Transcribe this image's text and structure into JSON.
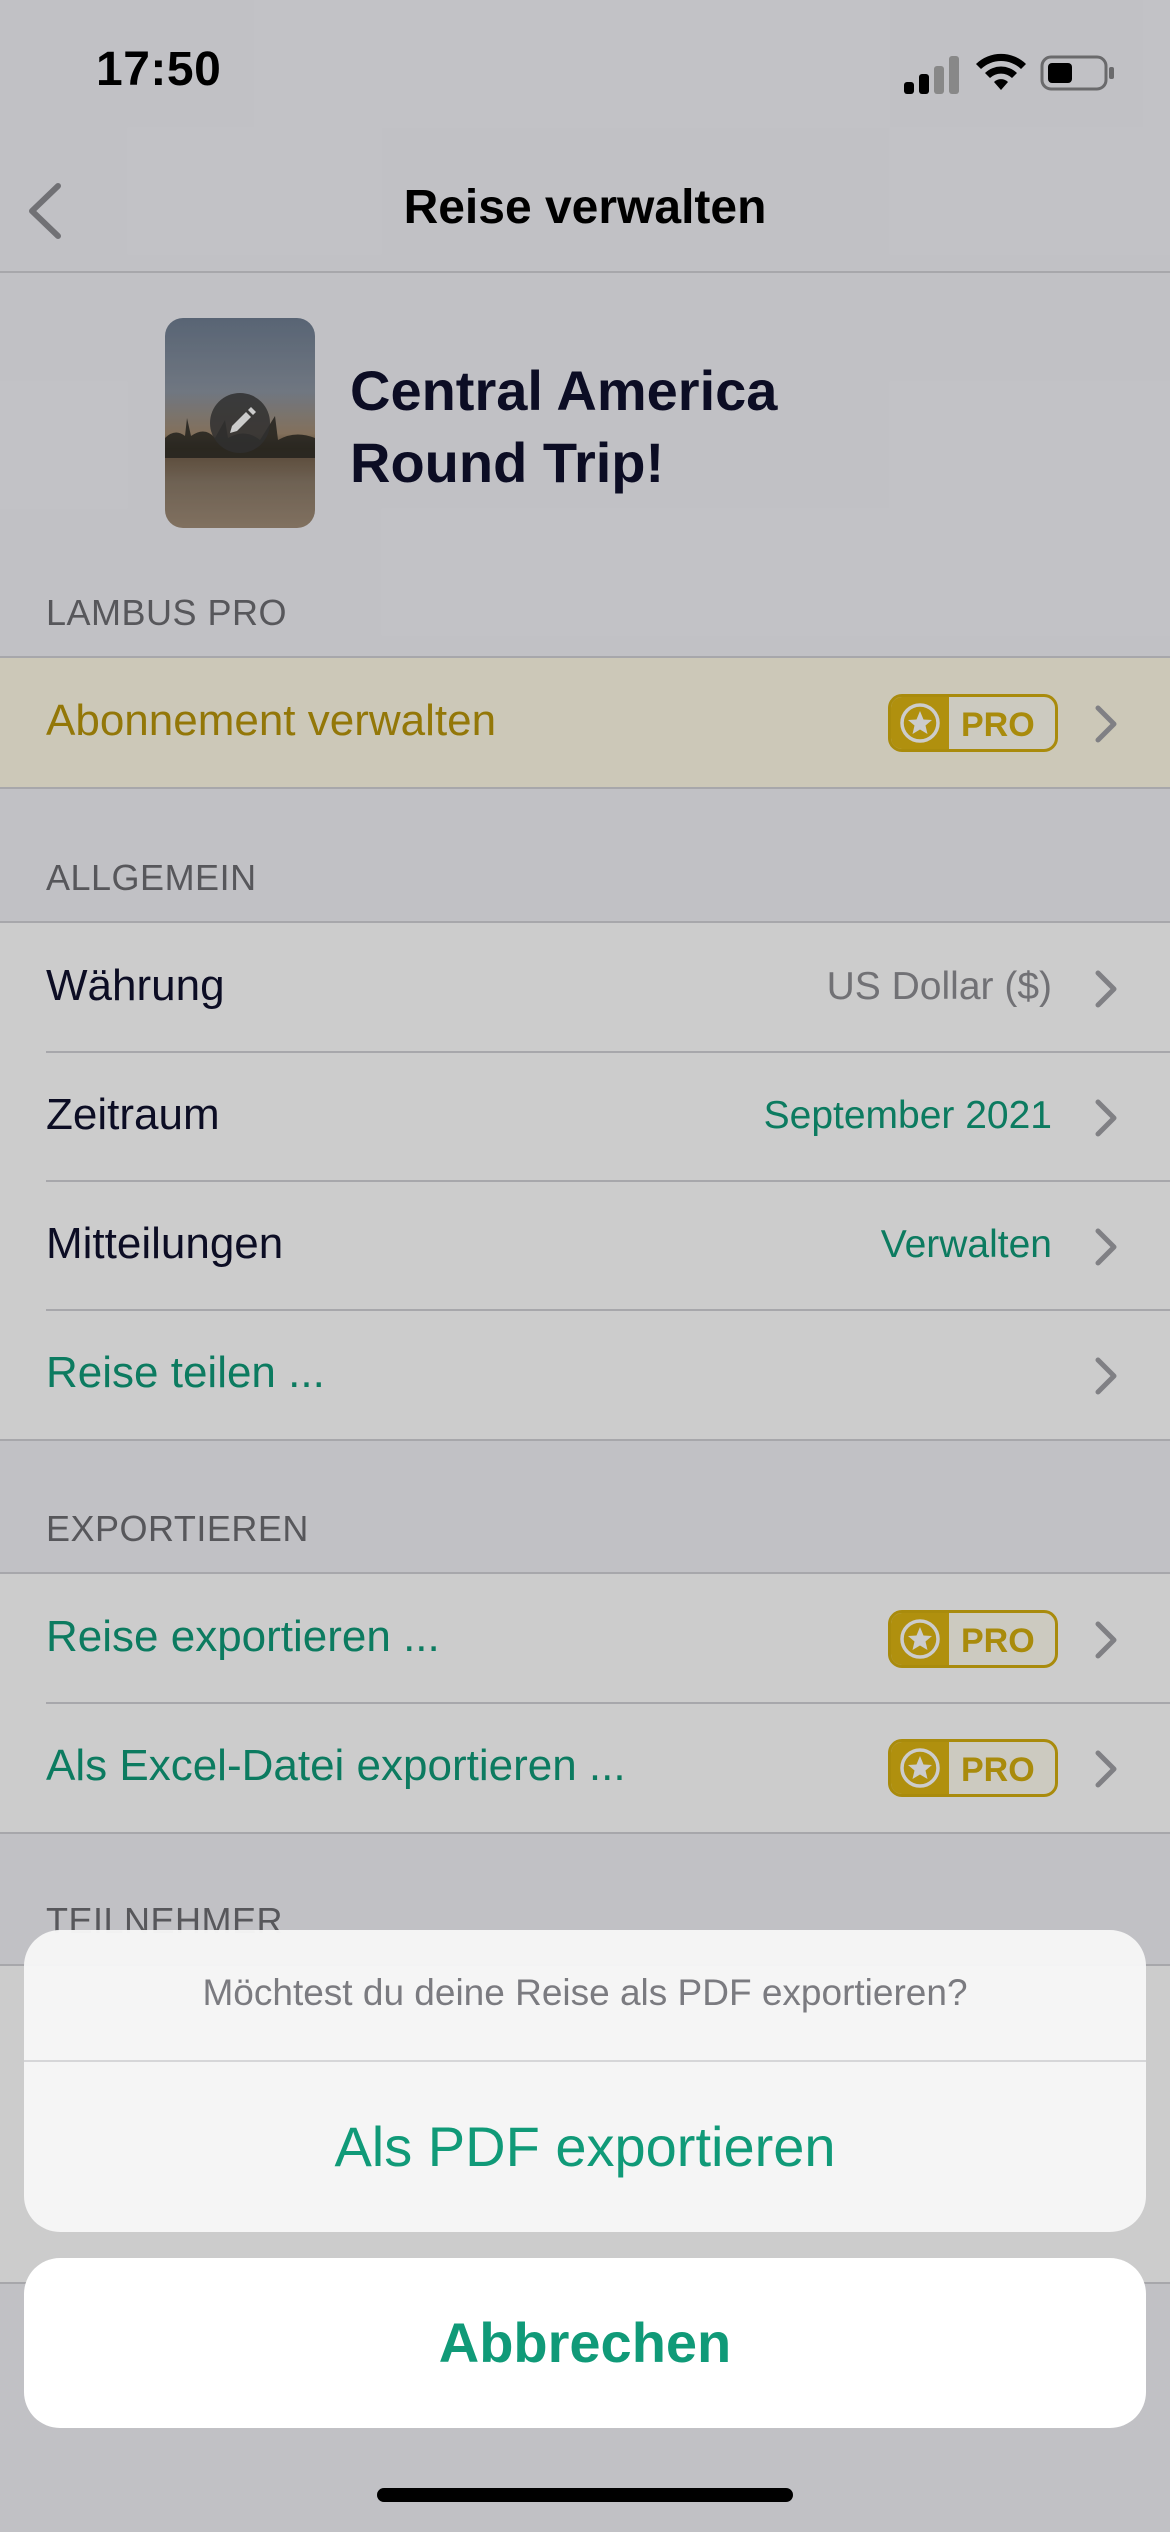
{
  "status_bar": {
    "time": "17:50"
  },
  "nav": {
    "title": "Reise verwalten"
  },
  "trip": {
    "title_line1": "Central America",
    "title_line2": "Round Trip!"
  },
  "sections": {
    "pro": {
      "header": "LAMBUS PRO",
      "rows": [
        {
          "label": "Abonnement verwalten",
          "badge": "PRO"
        }
      ]
    },
    "general": {
      "header": "ALLGEMEIN",
      "rows": [
        {
          "label": "Währung",
          "value": "US Dollar ($)"
        },
        {
          "label": "Zeitraum",
          "value": "September 2021"
        },
        {
          "label": "Mitteilungen",
          "value": "Verwalten"
        },
        {
          "label": "Reise teilen ..."
        }
      ]
    },
    "export": {
      "header": "EXPORTIEREN",
      "rows": [
        {
          "label": "Reise exportieren ...",
          "badge": "PRO"
        },
        {
          "label": "Als Excel-Datei exportieren ...",
          "badge": "PRO"
        }
      ]
    },
    "participants": {
      "header": "TEILNEHMER"
    }
  },
  "action_sheet": {
    "message": "Möchtest du deine Reise als PDF exportieren?",
    "action": "Als PDF exportieren",
    "cancel": "Abbrechen"
  },
  "colors": {
    "accent": "#109a78",
    "pro_gold": "#d4ae10",
    "title_navy": "#10112e"
  }
}
